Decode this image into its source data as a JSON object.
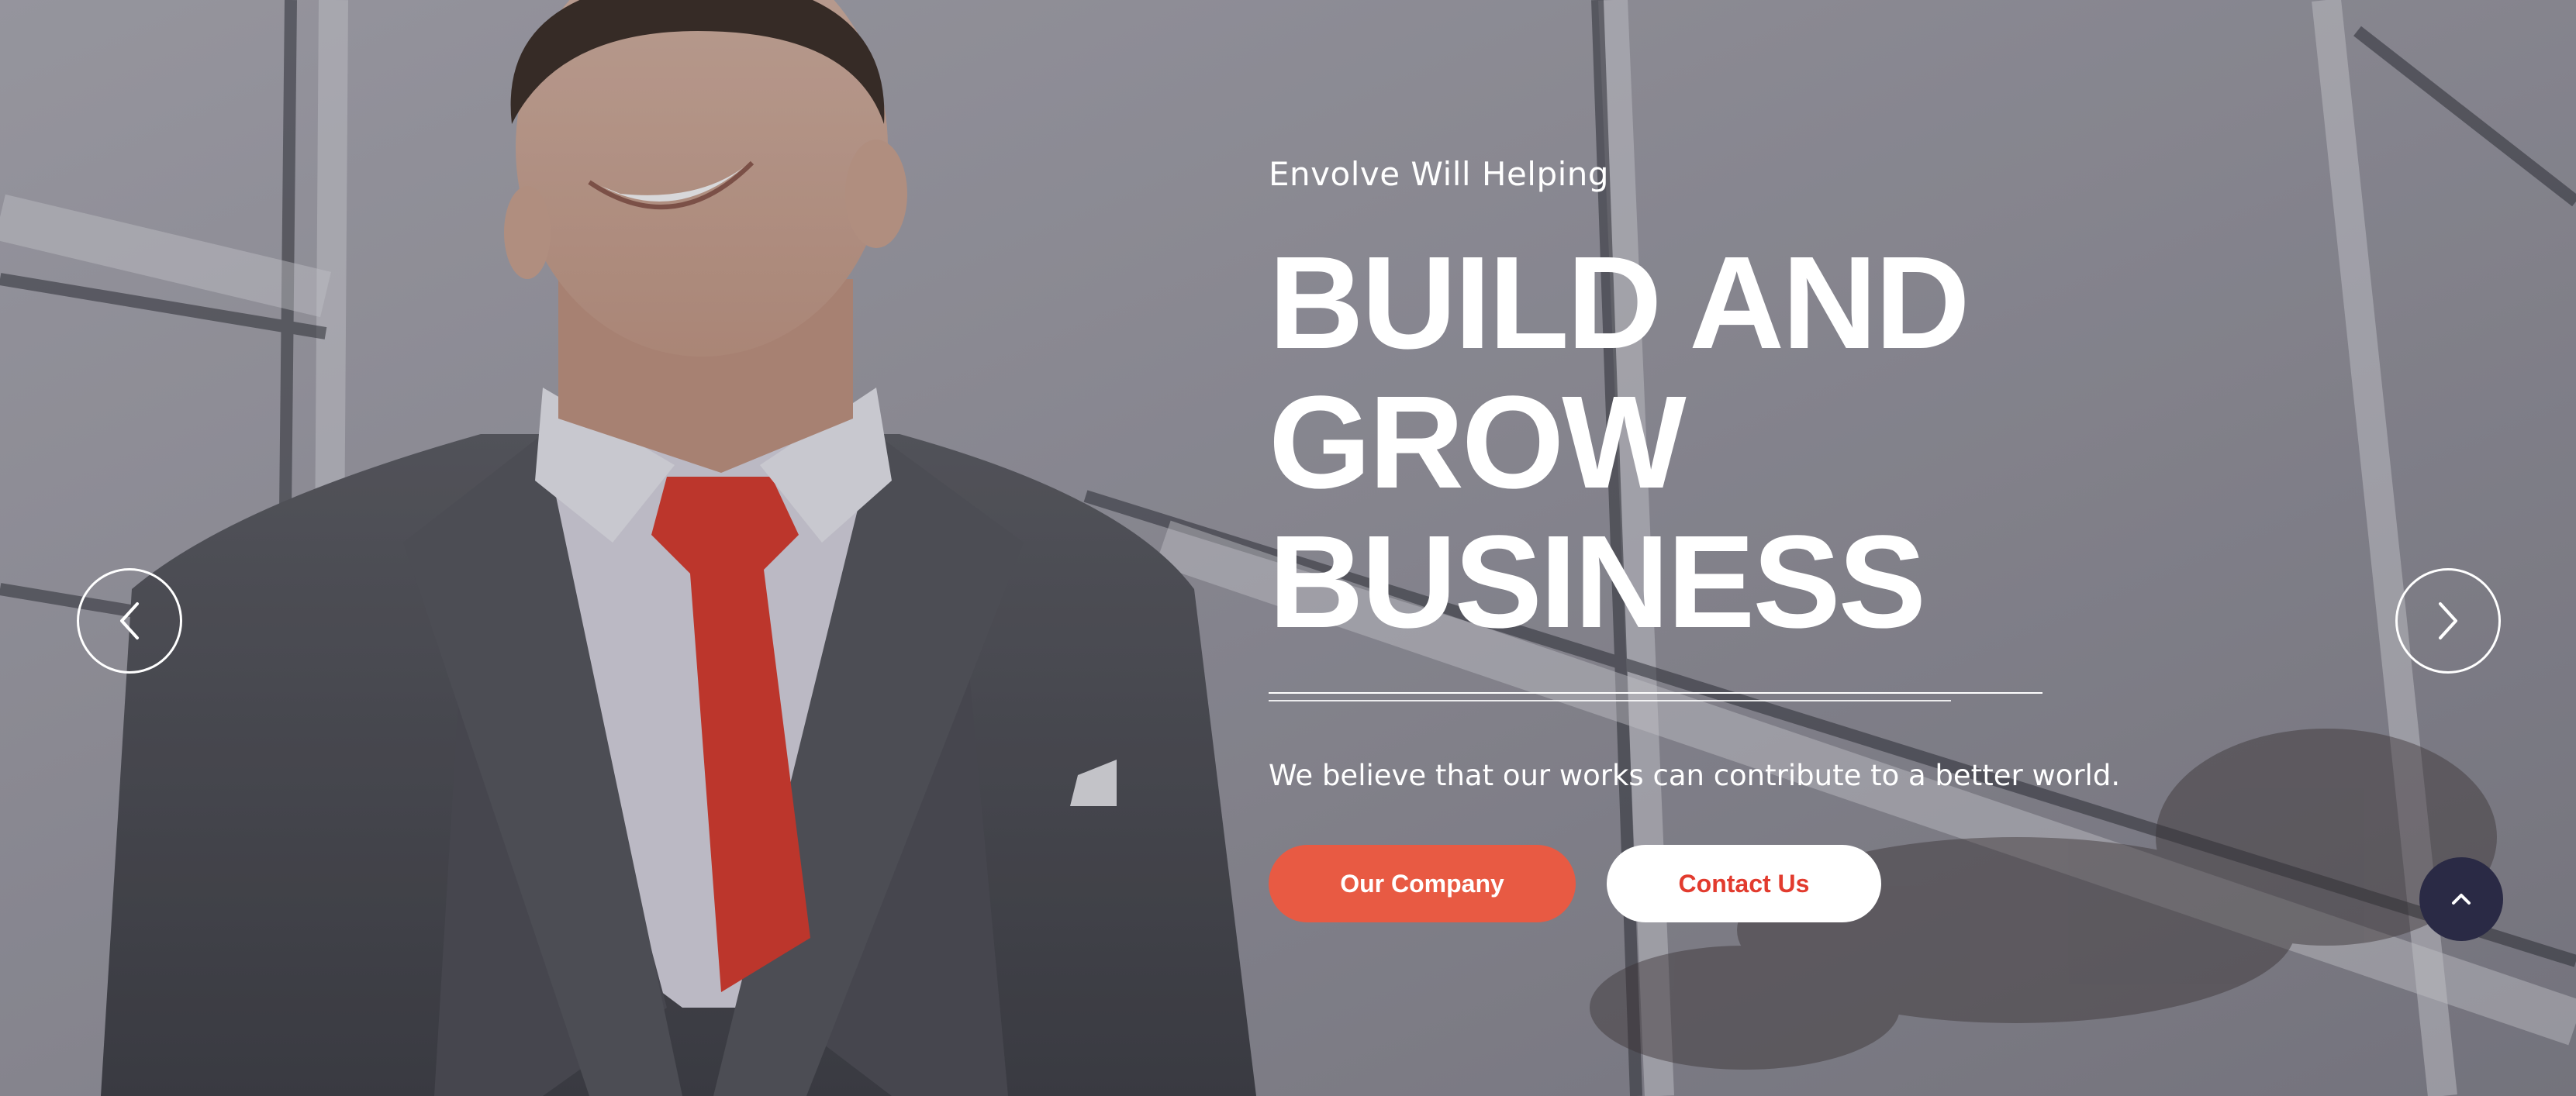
{
  "hero": {
    "eyebrow": "Envolve Will Helping",
    "headline_line1": "BUILD AND",
    "headline_line2": "GROW BUSINESS",
    "subtitle": "We believe that our works can contribute to a better world."
  },
  "buttons": {
    "primary_label": "Our Company",
    "secondary_label": "Contact Us"
  },
  "icons": {
    "prev": "chevron-left-icon",
    "next": "chevron-right-icon",
    "scroll_top": "chevron-up-icon"
  },
  "colors": {
    "accent": "#e85a43",
    "secondary_text": "#e23b2e",
    "scroll_top_bg": "#2a2a45"
  }
}
